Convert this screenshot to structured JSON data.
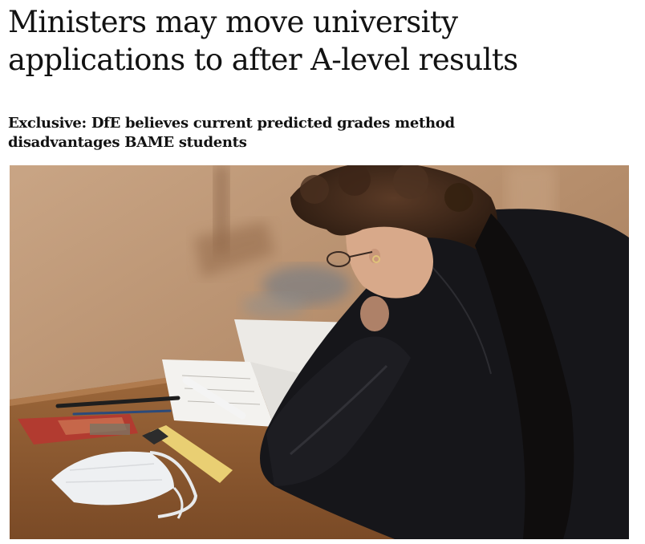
{
  "article": {
    "headline": "Ministers may move university applications to after A-level results",
    "standfirst": "Exclusive: DfE believes current predicted grades method disadvantages BAME students"
  },
  "photo": {
    "subject": "student-writing-at-exam-desk"
  }
}
